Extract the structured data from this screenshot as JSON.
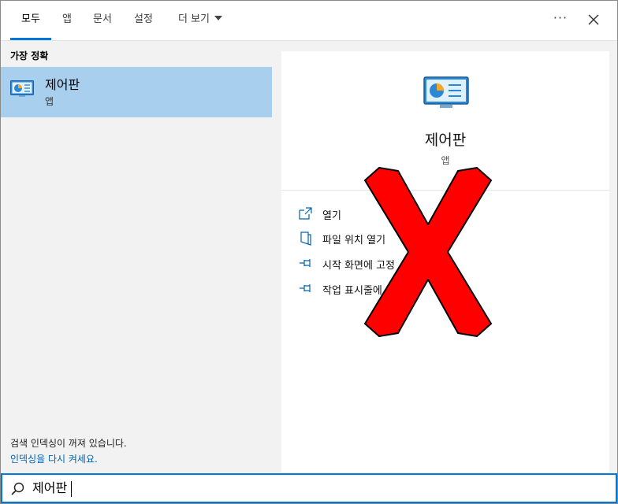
{
  "tabs": [
    {
      "label": "모두",
      "active": true
    },
    {
      "label": "앱",
      "active": false
    },
    {
      "label": "문서",
      "active": false
    },
    {
      "label": "설정",
      "active": false
    },
    {
      "label": "더 보기",
      "active": false,
      "dropdown": true
    }
  ],
  "toolbar": {
    "more_icon": "ellipsis-icon",
    "more_glyph": "···",
    "close_icon": "close-icon"
  },
  "left_pane": {
    "heading": "가장 정확",
    "result": {
      "title": "제어판",
      "subtitle": "앱",
      "icon": "control-panel-icon"
    },
    "index_notice": {
      "text": "검색 인덱싱이 꺼져 있습니다.",
      "link": "인덱싱을 다시 켜세요."
    }
  },
  "detail": {
    "title": "제어판",
    "subtitle": "앱",
    "icon": "control-panel-icon",
    "actions": [
      {
        "label": "열기",
        "icon": "open-icon"
      },
      {
        "label": "파일 위치 열기",
        "icon": "file-location-icon"
      },
      {
        "label": "시작 화면에 고정",
        "icon": "pin-icon"
      },
      {
        "label": "작업 표시줄에 고정",
        "icon": "pin-icon"
      }
    ]
  },
  "overlay": {
    "icon": "red-x-mark-icon",
    "color": "#ff0000"
  },
  "search": {
    "value": "제어판",
    "icon": "search-icon"
  },
  "colors": {
    "accent": "#0078d7",
    "selected": "#a9cfee",
    "link": "#0063b1"
  }
}
